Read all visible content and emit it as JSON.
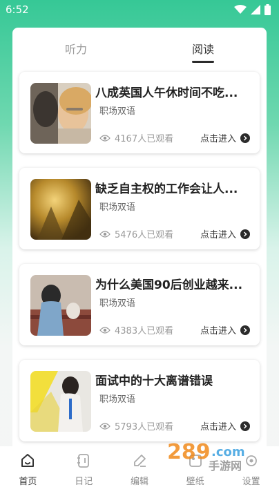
{
  "status_bar": {
    "time": "6:52"
  },
  "tabs": [
    {
      "label": "听力",
      "active": false
    },
    {
      "label": "阅读",
      "active": true
    }
  ],
  "articles": [
    {
      "title": "八成英国人午休时间不吃...",
      "category": "职场双语",
      "views": "4167人已观看",
      "enter": "点击进入"
    },
    {
      "title": "缺乏自主权的工作会让人...",
      "category": "职场双语",
      "views": "5476人已观看",
      "enter": "点击进入"
    },
    {
      "title": "为什么美国90后创业越来...",
      "category": "职场双语",
      "views": "4383人已观看",
      "enter": "点击进入"
    },
    {
      "title": "面试中的十大离谱错误",
      "category": "职场双语",
      "views": "5793人已观看",
      "enter": "点击进入"
    }
  ],
  "bottom_nav": [
    {
      "label": "首页",
      "icon": "home-icon",
      "active": true
    },
    {
      "label": "日记",
      "icon": "notebook-icon",
      "active": false
    },
    {
      "label": "编辑",
      "icon": "edit-icon",
      "active": false
    },
    {
      "label": "壁纸",
      "icon": "wallpaper-icon",
      "active": false
    },
    {
      "label": "设置",
      "icon": "settings-icon",
      "active": false
    }
  ],
  "watermark": {
    "text": "289.com 手游网"
  },
  "colors": {
    "accent": "#36c896",
    "text_dark": "#222222",
    "text_muted": "#9a9a9a"
  }
}
